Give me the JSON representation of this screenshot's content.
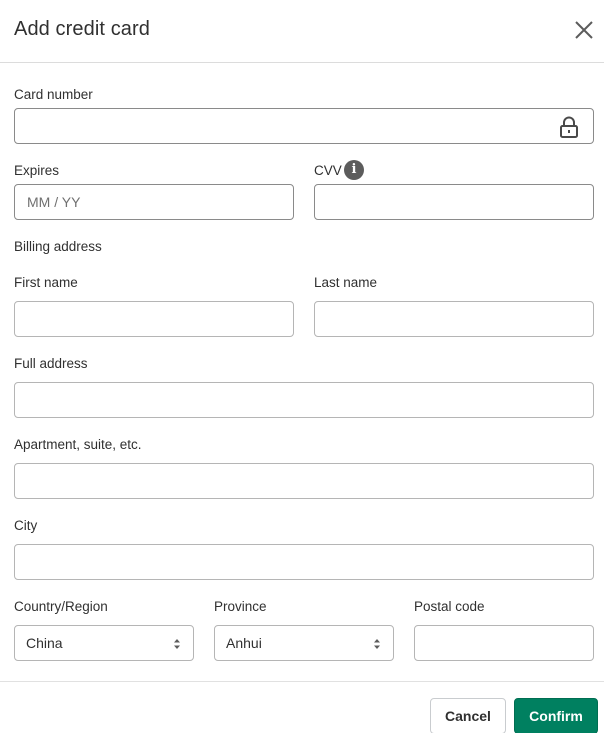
{
  "dialog": {
    "title": "Add credit card",
    "close_icon": "close-icon"
  },
  "card": {
    "number_label": "Card number",
    "number_value": "",
    "lock_icon": "lock-icon",
    "expires_label": "Expires",
    "expires_placeholder": "MM / YY",
    "expires_value": "",
    "cvv_label": "CVV",
    "cvv_info_icon": "info-icon",
    "cvv_info_glyph": "i",
    "cvv_value": ""
  },
  "billing": {
    "section_label": "Billing address",
    "first_name_label": "First name",
    "first_name_value": "",
    "last_name_label": "Last name",
    "last_name_value": "",
    "full_address_label": "Full address",
    "full_address_value": "",
    "apartment_label": "Apartment, suite, etc.",
    "apartment_value": "",
    "city_label": "City",
    "city_value": "",
    "country_label": "Country/Region",
    "country_value": "China",
    "province_label": "Province",
    "province_value": "Anhui",
    "postal_label": "Postal code",
    "postal_value": ""
  },
  "footer": {
    "cancel_label": "Cancel",
    "confirm_label": "Confirm"
  },
  "colors": {
    "primary": "#008060",
    "text": "#303030",
    "border": "#8a8a8a"
  }
}
